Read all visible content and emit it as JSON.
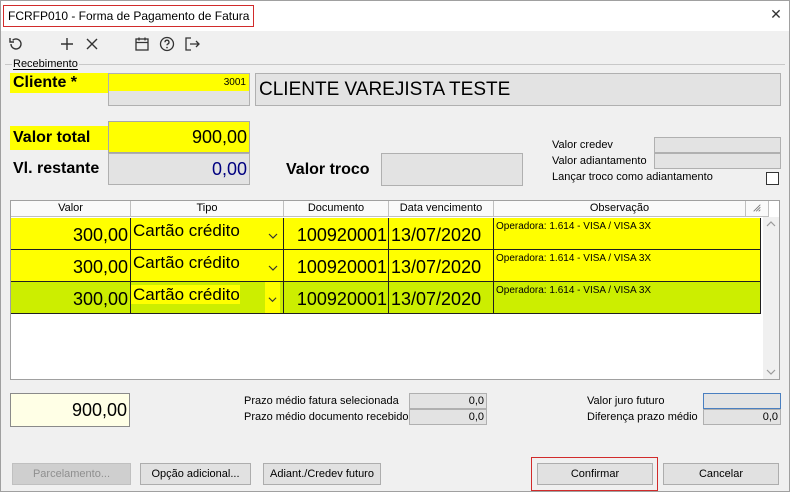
{
  "window": {
    "title": "FCRFP010 - Forma de Pagamento de Fatura",
    "close_glyph": "✕"
  },
  "toolbar": {
    "icons": [
      "refresh-icon",
      "add-icon",
      "delete-icon",
      "calendar-icon",
      "help-icon",
      "exit-icon"
    ]
  },
  "recebimento": {
    "group_label": "Recebimento",
    "cliente_label": "Cliente *",
    "cliente_code": "3001",
    "cliente_name": "CLIENTE VAREJISTA TESTE",
    "valor_total_label": "Valor total",
    "valor_total": "900,00",
    "vl_restante_label": "Vl. restante",
    "vl_restante": "0,00",
    "valor_troco_label": "Valor troco",
    "valor_troco": "",
    "valor_credev_label": "Valor credev",
    "valor_adiantamento_label": "Valor adiantamento",
    "lancar_troco_label": "Lançar troco como adiantamento"
  },
  "grid": {
    "columns": [
      "Valor",
      "Tipo",
      "Documento",
      "Data vencimento",
      "Observação"
    ],
    "rows": [
      {
        "valor": "300,00",
        "tipo": "Cartão crédito",
        "documento": "100920001",
        "data": "13/07/2020",
        "obs": "Operadora: 1.614 - VISA / VISA 3X"
      },
      {
        "valor": "300,00",
        "tipo": "Cartão crédito",
        "documento": "100920001",
        "data": "13/07/2020",
        "obs": "Operadora: 1.614 - VISA / VISA 3X"
      },
      {
        "valor": "300,00",
        "tipo": "Cartão crédito",
        "documento": "100920001",
        "data": "13/07/2020",
        "obs": "Operadora: 1.614 - VISA / VISA 3X"
      }
    ]
  },
  "footer": {
    "total": "900,00",
    "prazo_fatura_label": "Prazo médio fatura selecionada",
    "prazo_fatura": "0,0",
    "prazo_doc_label": "Prazo médio documento recebido",
    "prazo_doc": "0,0",
    "juro_futuro_label": "Valor juro futuro",
    "juro_futuro": "",
    "diferenca_label": "Diferença prazo médio",
    "diferenca": "0,0"
  },
  "buttons": {
    "parcelamento": "Parcelamento...",
    "opcao_adicional": "Opção adicional...",
    "adiant_credev": "Adiant./Credev futuro",
    "confirmar": "Confirmar",
    "cancelar": "Cancelar"
  },
  "colors": {
    "yellow": "#ffff00",
    "selected_row": "#ccee00",
    "focus_red": "#d12b2b",
    "restante_blue": "#000080"
  }
}
